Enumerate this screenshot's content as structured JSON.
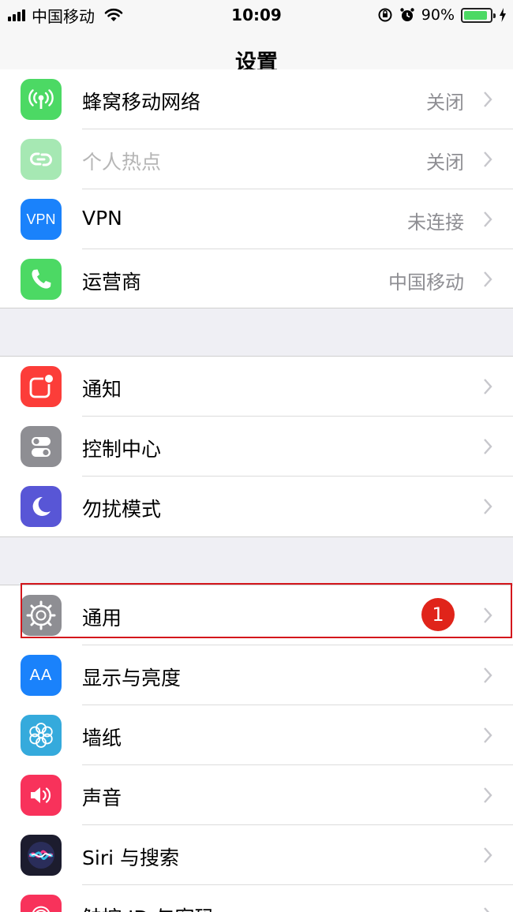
{
  "status_bar": {
    "carrier": "中国移动",
    "time": "10:09",
    "battery_percent": "90%",
    "battery_level": 0.9,
    "icons": [
      "signal-icon",
      "wifi-icon",
      "orientation-lock-icon",
      "alarm-icon",
      "battery-icon",
      "charging-icon"
    ]
  },
  "nav": {
    "title": "设置"
  },
  "groups": [
    {
      "items": [
        {
          "label": "蜂窝移动网络",
          "value": "关闭",
          "icon": "cellular-icon",
          "color": "#4cd964"
        },
        {
          "label": "个人热点",
          "value": "关闭",
          "icon": "hotspot-icon",
          "color": "#a6e8b3",
          "disabled": true
        },
        {
          "label": "VPN",
          "value": "未连接",
          "icon": "vpn-icon",
          "icon_text": "VPN",
          "color": "#1a82fb"
        },
        {
          "label": "运营商",
          "value": "中国移动",
          "icon": "phone-icon",
          "color": "#4cd964"
        }
      ]
    },
    {
      "items": [
        {
          "label": "通知",
          "value": "",
          "icon": "notifications-icon",
          "color": "#fc3d39"
        },
        {
          "label": "控制中心",
          "value": "",
          "icon": "control-center-icon",
          "color": "#8e8e93"
        },
        {
          "label": "勿扰模式",
          "value": "",
          "icon": "moon-icon",
          "color": "#5856d6"
        }
      ]
    },
    {
      "items": [
        {
          "label": "通用",
          "value": "",
          "icon": "gear-icon",
          "color": "#8e8e93"
        },
        {
          "label": "显示与亮度",
          "value": "",
          "icon": "display-brightness-icon",
          "icon_text": "AA",
          "color": "#1a82fb"
        },
        {
          "label": "墙纸",
          "value": "",
          "icon": "wallpaper-icon",
          "color": "#35aadc"
        },
        {
          "label": "声音",
          "value": "",
          "icon": "speaker-icon",
          "color": "#f8325b"
        },
        {
          "label": "Siri 与搜索",
          "value": "",
          "icon": "siri-icon",
          "color": "#1c1c2e"
        },
        {
          "label": "触控 ID 与密码",
          "value": "",
          "icon": "touch-id-icon",
          "color": "#f8325b"
        }
      ]
    }
  ],
  "annotation": {
    "step_number": "1",
    "target": "通用",
    "color": "#d4161c"
  }
}
